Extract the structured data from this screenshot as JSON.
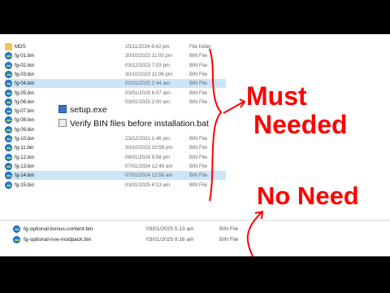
{
  "file_list": [
    {
      "name": "MDS",
      "date": "25/11/2024 8:42 pm",
      "type": "File folder",
      "icon": "folder-icon"
    },
    {
      "name": "fg-01.bin",
      "date": "30/10/2023 11:05 pm",
      "type": "BIN File",
      "icon": "bin-file-icon"
    },
    {
      "name": "fg-02.bin",
      "date": "03/12/2023 7:03 pm",
      "type": "BIN File",
      "icon": "bin-file-icon"
    },
    {
      "name": "fg-03.bin",
      "date": "30/10/2023 11:06 pm",
      "type": "BIN File",
      "icon": "bin-file-icon"
    },
    {
      "name": "fg-04.bin",
      "date": "02/01/2025 2:44 am",
      "type": "BIN File",
      "icon": "bin-file-icon",
      "selected": true
    },
    {
      "name": "fg-05.bin",
      "date": "03/01/2025 6:07 am",
      "type": "BIN File",
      "icon": "bin-file-icon"
    },
    {
      "name": "fg-06.bin",
      "date": "03/01/2025 3:00 am",
      "type": "BIN File",
      "icon": "bin-file-icon"
    },
    {
      "name": "fg-07.bin",
      "date": "",
      "type": "",
      "icon": "bin-file-icon"
    },
    {
      "name": "fg-08.bin",
      "date": "",
      "type": "",
      "icon": "bin-file-icon"
    },
    {
      "name": "fg-09.bin",
      "date": "",
      "type": "",
      "icon": "bin-file-icon"
    },
    {
      "name": "fg-10.bin",
      "date": "23/12/2021 1:46 pm",
      "type": "BIN File",
      "icon": "bin-file-icon"
    },
    {
      "name": "fg-11.bin",
      "date": "30/10/2023 10:59 pm",
      "type": "BIN File",
      "icon": "bin-file-icon"
    },
    {
      "name": "fg-12.bin",
      "date": "06/01/2024 9:58 pm",
      "type": "BIN File",
      "icon": "bin-file-icon"
    },
    {
      "name": "fg-13.bin",
      "date": "07/01/2024 12:49 am",
      "type": "BIN File",
      "icon": "bin-file-icon"
    },
    {
      "name": "fg-14.bin",
      "date": "07/01/2024 12:56 am",
      "type": "BIN File",
      "icon": "bin-file-icon",
      "selected": true
    },
    {
      "name": "fg-15.bin",
      "date": "03/01/2025 4:13 am",
      "type": "BIN File",
      "icon": "bin-file-icon"
    }
  ],
  "floating_items": [
    {
      "name": "setup.exe",
      "icon": "exe-icon"
    },
    {
      "name": "Verify BIN files before installation.bat",
      "icon": "bat-icon"
    }
  ],
  "optional_files": [
    {
      "name": "fg-optional-bonus-content.bin",
      "date": "03/01/2025 5:13 am",
      "type": "BIN File",
      "icon": "bin-file-icon"
    },
    {
      "name": "fg-optional-nve-modpack.bin",
      "date": "03/01/2025 8:16 am",
      "type": "BIN File",
      "icon": "bin-file-icon"
    }
  ],
  "annotations": {
    "must_line1": "Must",
    "must_line2": "Needed",
    "no_need": "No Need",
    "color": "#ff0000"
  }
}
